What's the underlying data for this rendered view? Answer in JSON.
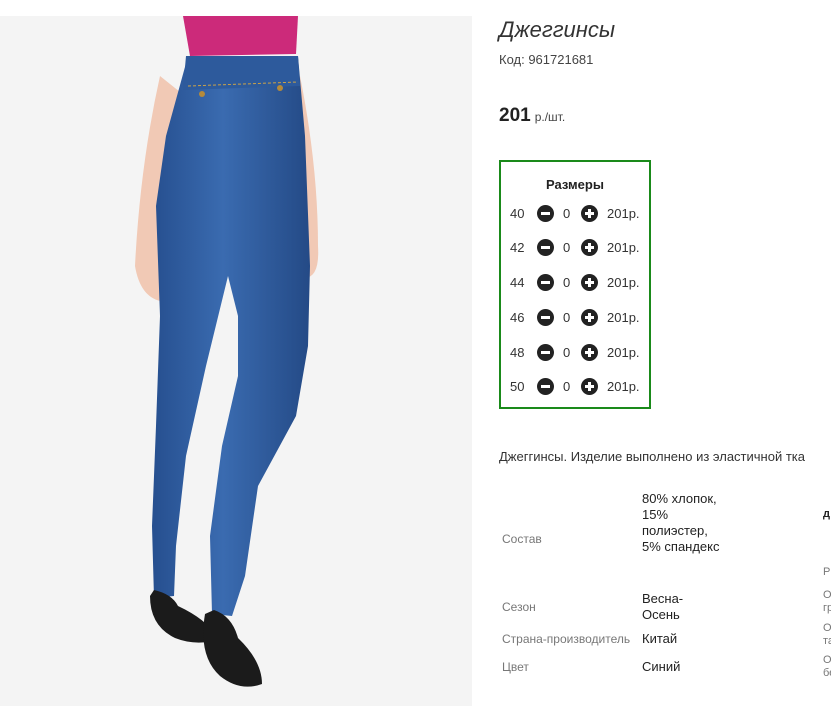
{
  "product": {
    "title": "Джеггинсы",
    "code_text": "Код: 961721681",
    "price_value": "201",
    "price_unit": "р./шт.",
    "image_alt": "product-photo-jeggings"
  },
  "sizes": {
    "title": "Размеры",
    "rows": [
      {
        "size": "40",
        "qty": "0",
        "price": "201р."
      },
      {
        "size": "42",
        "qty": "0",
        "price": "201р."
      },
      {
        "size": "44",
        "qty": "0",
        "price": "201р."
      },
      {
        "size": "46",
        "qty": "0",
        "price": "201р."
      },
      {
        "size": "48",
        "qty": "0",
        "price": "201р."
      },
      {
        "size": "50",
        "qty": "0",
        "price": "201р."
      }
    ]
  },
  "description": "Джеггинсы. Изделие выполнено из эластичной тка",
  "attributes": [
    {
      "label": "Состав",
      "value": "80% хлопок, 15% полиэстер, 5% спандекс"
    },
    {
      "label": "Сезон",
      "value": "Весна-Осень"
    },
    {
      "label": "Страна-производитель",
      "value": "Китай"
    },
    {
      "label": "Цвет",
      "value": "Синий"
    }
  ],
  "cutoff_column": [
    "д",
    "Р",
    "О",
    "гр",
    "О",
    "та",
    "О",
    "бе"
  ],
  "colors": {
    "border_green": "#1a8a1a",
    "denim_blue": "#2f5c9e",
    "shirt_magenta": "#cc2a7a"
  }
}
